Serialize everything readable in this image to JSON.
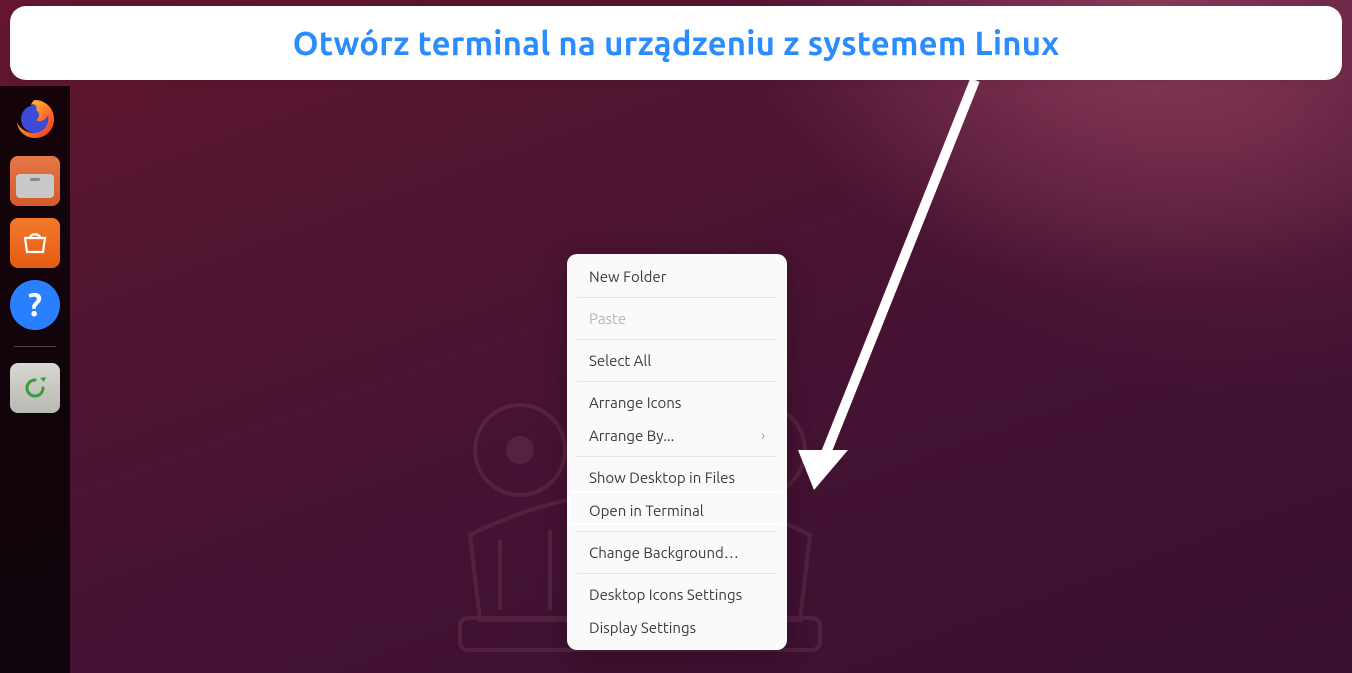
{
  "annotation": {
    "title": "Otwórz terminal na urządzeniu z systemem Linux"
  },
  "dock": {
    "items": [
      {
        "name": "firefox"
      },
      {
        "name": "files"
      },
      {
        "name": "software"
      },
      {
        "name": "help"
      },
      {
        "name": "trash"
      }
    ]
  },
  "context_menu": {
    "items": [
      {
        "label": "New Folder",
        "enabled": true,
        "submenu": false
      },
      {
        "sep": true
      },
      {
        "label": "Paste",
        "enabled": false,
        "submenu": false
      },
      {
        "sep": true
      },
      {
        "label": "Select All",
        "enabled": true,
        "submenu": false
      },
      {
        "sep": true
      },
      {
        "label": "Arrange Icons",
        "enabled": true,
        "submenu": false
      },
      {
        "label": "Arrange By...",
        "enabled": true,
        "submenu": true
      },
      {
        "sep": true
      },
      {
        "label": "Show Desktop in Files",
        "enabled": true,
        "submenu": false
      },
      {
        "label": "Open in Terminal",
        "enabled": true,
        "submenu": false,
        "highlighted": true
      },
      {
        "sep": true
      },
      {
        "label": "Change Background…",
        "enabled": true,
        "submenu": false
      },
      {
        "sep": true
      },
      {
        "label": "Desktop Icons Settings",
        "enabled": true,
        "submenu": false
      },
      {
        "label": "Display Settings",
        "enabled": true,
        "submenu": false
      }
    ]
  },
  "highlight_color": "#ffffff",
  "annotation_color": "#2a8cff"
}
